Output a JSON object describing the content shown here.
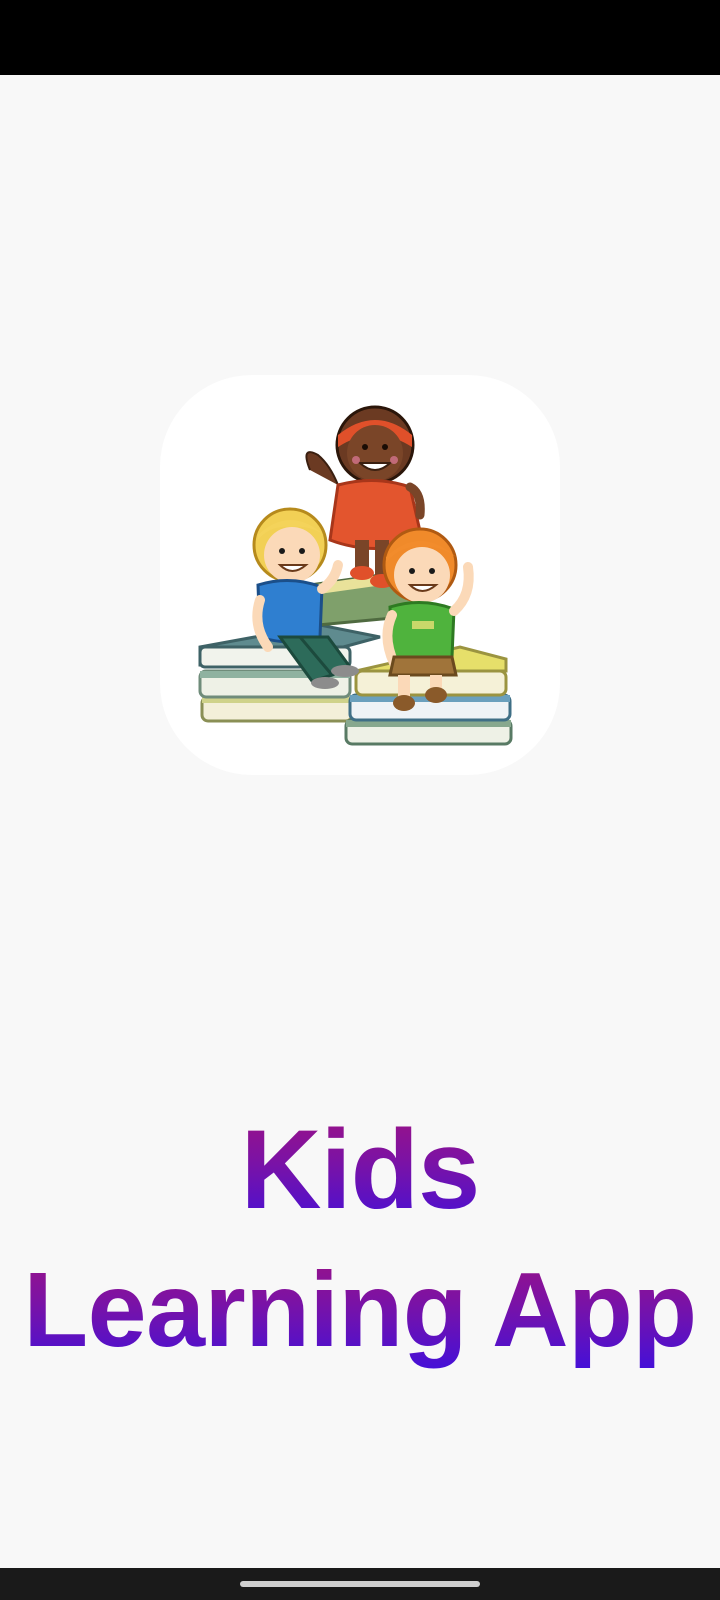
{
  "app": {
    "title_line1": "Kids",
    "title_line2": "Learning App"
  },
  "logo": {
    "icon": "kids-on-books-illustration-icon"
  },
  "colors": {
    "background": "#f8f8f8",
    "title_gradient_top": "#a3127d",
    "title_gradient_bottom": "#3c10e0",
    "status_bar": "#000000",
    "nav_bar": "#1a1a1a"
  }
}
